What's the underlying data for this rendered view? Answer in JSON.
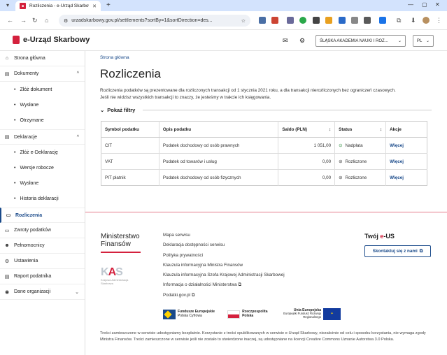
{
  "browser": {
    "tab_title": "Rozliczenia - e-Urząd Skarbowy",
    "url": "urzadskarbowy.gov.pl/settlements?sortBy=1&sortDirection=des..."
  },
  "header": {
    "brand": "e-Urząd Skarbowy",
    "org_select": "ŚLĄSKA AKADEMIA NAUKI I ROZ...",
    "lang_select": "PL"
  },
  "sidebar": {
    "items": [
      {
        "label": "Strona główna"
      },
      {
        "label": "Dokumenty"
      },
      {
        "label": "Złóż dokument"
      },
      {
        "label": "Wysłane"
      },
      {
        "label": "Otrzymane"
      },
      {
        "label": "Deklaracje"
      },
      {
        "label": "Złóż e-Deklarację"
      },
      {
        "label": "Wersje robocze"
      },
      {
        "label": "Wysłane"
      },
      {
        "label": "Historia deklaracji"
      },
      {
        "label": "Rozliczenia"
      },
      {
        "label": "Zwroty podatków"
      },
      {
        "label": "Pełnomocnicy"
      },
      {
        "label": "Ustawienia"
      },
      {
        "label": "Raport podatnika"
      },
      {
        "label": "Dane organizacji"
      }
    ]
  },
  "main": {
    "breadcrumb": "Strona główna",
    "title": "Rozliczenia",
    "info_line1": "Rozliczenia podatków są prezentowane dla rozliczonych transakcji od 1 stycznia 2021 roku, a dla transakcji nierozliczonych bez ograniczeń czasowych.",
    "info_line2": "Jeśli nie widzisz wszystkich transakcji to znaczy, że jesteśmy w trakcie ich księgowania.",
    "filters": "Pokaż filtry",
    "table": {
      "headers": [
        "Symbol podatku",
        "Opis podatku",
        "Saldo (PLN)",
        "Status",
        "Akcje"
      ],
      "rows": [
        {
          "symbol": "CIT",
          "opis": "Podatek dochodowy od osób prawnych",
          "saldo": "1 051,00",
          "status": "Nadpłata",
          "akcja": "Więcej"
        },
        {
          "symbol": "VAT",
          "opis": "Podatek od towarów i usług",
          "saldo": "0,00",
          "status": "Rozliczone",
          "akcja": "Więcej"
        },
        {
          "symbol": "PIT płatnik",
          "opis": "Podatek dochodowy od osób fizycznych",
          "saldo": "0,00",
          "status": "Rozliczone",
          "akcja": "Więcej"
        }
      ]
    }
  },
  "footer": {
    "ministry_line1": "Ministerstwo",
    "ministry_line2": "Finansów",
    "kas_text": "Krajowa Administracja Skarbowa",
    "links": [
      "Mapa serwisu",
      "Deklaracja dostępności serwisu",
      "Polityka prywatności",
      "Klauzula informacyjna Ministra Finansów",
      "Klauzula informacyjna Szefa Krajowej Administracji Skarbowej",
      "Informacja o działalności Ministerstwa",
      "Podatki.gov.pl"
    ],
    "twoj_prefix": "Twój ",
    "twoj_e": "e",
    "twoj_suffix": "-US",
    "contact_button": "Skontaktuj się z nami",
    "logo_fe_title": "Fundusze Europejskie",
    "logo_fe_sub": "Polska Cyfrowa",
    "logo_rp": "Rzeczpospolita Polska",
    "logo_ue_title": "Unia Europejska",
    "logo_ue_sub": "Europejski Fundusz Rozwoju Regionalnego",
    "disclaimer": "Treści zamieszczone w serwisie udostępniamy bezpłatnie. Korzystanie z treści opublikowanych w serwisie e-Urząd Skarbowy, niezależnie od celu i sposobu korzystania, nie wymaga zgody Ministra Finansów. Treści zamieszczone w serwisie jeśli nie zostało to stwierdzone inaczej, są udostępniane na licencji Creative Commons Uznanie Autorstwa 3.0 Polska."
  },
  "colors": {
    "accent": "#d4213d",
    "link": "#1a4a8a",
    "ok": "#2a8a3a"
  }
}
